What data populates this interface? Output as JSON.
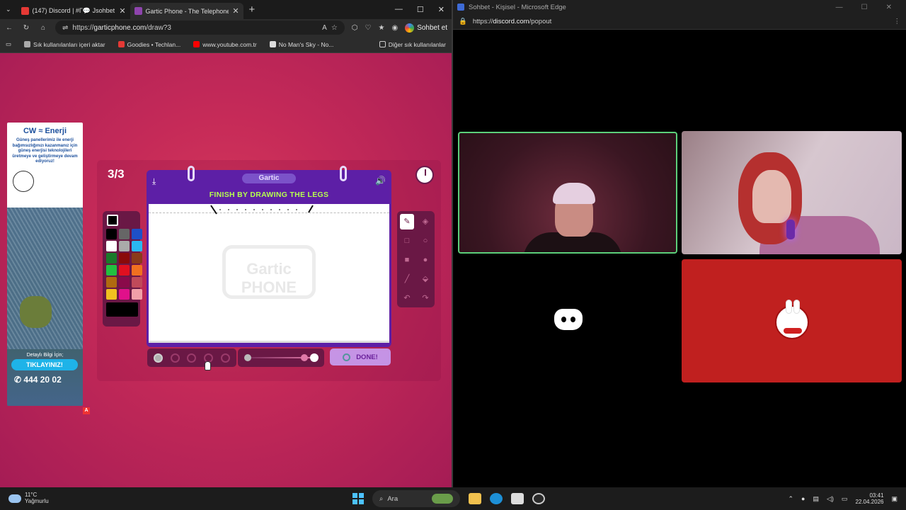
{
  "left_browser": {
    "tabs": [
      {
        "title": "(147) Discord | #Γ💬 Jsohbet",
        "color": "#e53935"
      },
      {
        "title": "Gartic Phone - The Telephone Gar",
        "color": "#8e44ad"
      }
    ],
    "url_prefix": "https://",
    "url_domain": "garticphone.com",
    "url_path": "/draw?3",
    "sohbet_label": "Sohbet et",
    "bookmarks": [
      {
        "label": "Sık kullanılanları içeri aktar",
        "color": "#aaaaaa"
      },
      {
        "label": "Goodies • Techlan...",
        "color": "#e53935"
      },
      {
        "label": "www.youtube.com.tr",
        "color": "#ff0000"
      },
      {
        "label": "No Man's Sky - No...",
        "color": "#dddddd"
      }
    ],
    "bookmarks_right": "Diğer sık kullanılanlar"
  },
  "ad": {
    "brand": "CW ≈ Enerji",
    "text": "Güneş panellerimiz ile enerji bağımsızlığınızı kazanmanız için güneş enerjisi teknolojileri üretmeye ve geliştirmeye devam ediyoruz!",
    "cta_small": "Detaylı Bilgi İçin;",
    "cta": "TIKLAYINIZ!",
    "phone": "✆ 444 20 02",
    "badge": "A"
  },
  "game": {
    "round": "3/3",
    "brand": "Gartic",
    "prompt": "FINISH BY DRAWING THE LEGS",
    "watermark": "Gartic PHONE",
    "done_label": "DONE!",
    "palette": [
      "#000000",
      "#666666",
      "#1e50c8",
      "#ffffff",
      "#aaaaaa",
      "#2ab8f0",
      "#1a7a2a",
      "#8a0a0a",
      "#8a3a1a",
      "#22c040",
      "#e01020",
      "#f07020",
      "#b06a10",
      "#8a0a4a",
      "#c04a5a",
      "#f0c020",
      "#e0108a",
      "#f0a0a8"
    ],
    "tools": [
      "pencil-icon",
      "fill-icon",
      "rect-outline-icon",
      "ellipse-outline-icon",
      "rect-fill-icon",
      "ellipse-fill-icon",
      "line-icon",
      "eraser-icon",
      "undo-icon",
      "redo-icon"
    ]
  },
  "right_browser": {
    "title": "Sohbet - Kişisel - Microsoft Edge",
    "url_prefix": "https://",
    "url_domain": "discord.com",
    "url_path": "/popout",
    "active_speaker_border": "#5ccf7a"
  },
  "taskbar": {
    "temp": "11°C",
    "weather": "Yağmurlu",
    "search": "Ara",
    "time": "03:41",
    "date": "22.04.2026"
  }
}
